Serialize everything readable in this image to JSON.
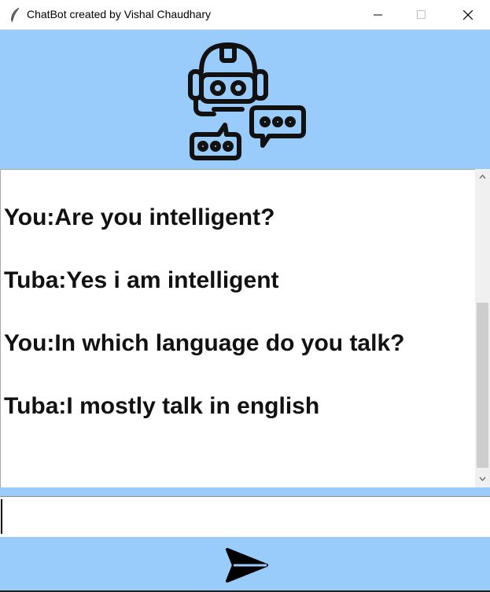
{
  "window": {
    "title": "ChatBot created by Vishal Chaudhary",
    "icon": "feather-icon",
    "controls": [
      "minimize-icon",
      "maximize-icon",
      "close-icon"
    ]
  },
  "header": {
    "logo_icon": "robot-chat-icon",
    "background_color": "#99ccfa"
  },
  "chat": {
    "messages": [
      {
        "text": "You:Are you intelligent?"
      },
      {
        "text": "Tuba:Yes i am intelligent"
      },
      {
        "text": "You:In which language do you talk?"
      },
      {
        "text": "Tuba:I mostly talk in english"
      }
    ]
  },
  "input": {
    "value": "",
    "placeholder": ""
  },
  "send": {
    "icon": "send-arrow-icon"
  }
}
